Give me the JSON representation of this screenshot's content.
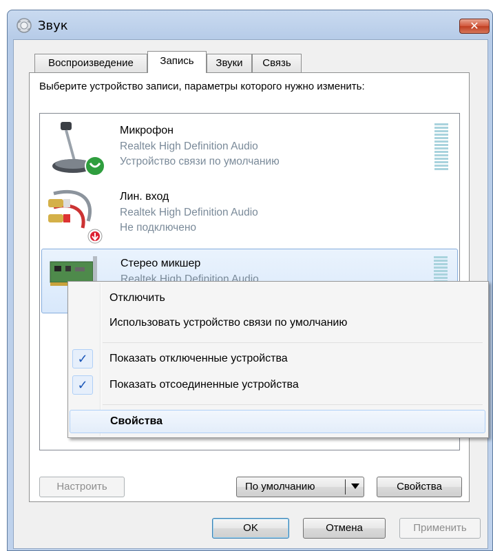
{
  "window": {
    "title": "Звук",
    "close_glyph": "✕"
  },
  "tabs": [
    {
      "label": "Воспроизведение",
      "active": false
    },
    {
      "label": "Запись",
      "active": true
    },
    {
      "label": "Звуки",
      "active": false
    },
    {
      "label": "Связь",
      "active": false
    }
  ],
  "instruction": "Выберите устройство записи, параметры которого нужно изменить:",
  "devices": [
    {
      "name": "Микрофон",
      "line2": "Realtek High Definition Audio",
      "line3": "Устройство связи по умолчанию",
      "icon": "microphone-icon",
      "selected": false
    },
    {
      "name": "Лин. вход",
      "line2": "Realtek High Definition Audio",
      "line3": "Не подключено",
      "icon": "line-in-cable-icon",
      "selected": false
    },
    {
      "name": "Стерео микшер",
      "line2": "Realtek High Definition Audio",
      "line3": "",
      "icon": "sound-card-icon",
      "selected": true
    }
  ],
  "context_menu": {
    "items": [
      {
        "label": "Отключить",
        "checked": false
      },
      {
        "label": "Использовать устройство связи по умолчанию",
        "checked": false
      },
      {
        "label": "Показать отключенные устройства",
        "checked": true
      },
      {
        "label": "Показать отсоединенные устройства",
        "checked": true
      },
      {
        "label": "Свойства",
        "bold": true,
        "highlighted": true
      }
    ],
    "check_glyph": "✓"
  },
  "panel_buttons": {
    "configure": "Настроить",
    "set_default": "По умолчанию",
    "properties": "Свойства"
  },
  "dialog_buttons": {
    "ok": "OK",
    "cancel": "Отмена",
    "apply": "Применить"
  },
  "colors": {
    "accent": "#1a56b8",
    "title_bar": "#b7cce8",
    "close_button": "#c03e21"
  }
}
